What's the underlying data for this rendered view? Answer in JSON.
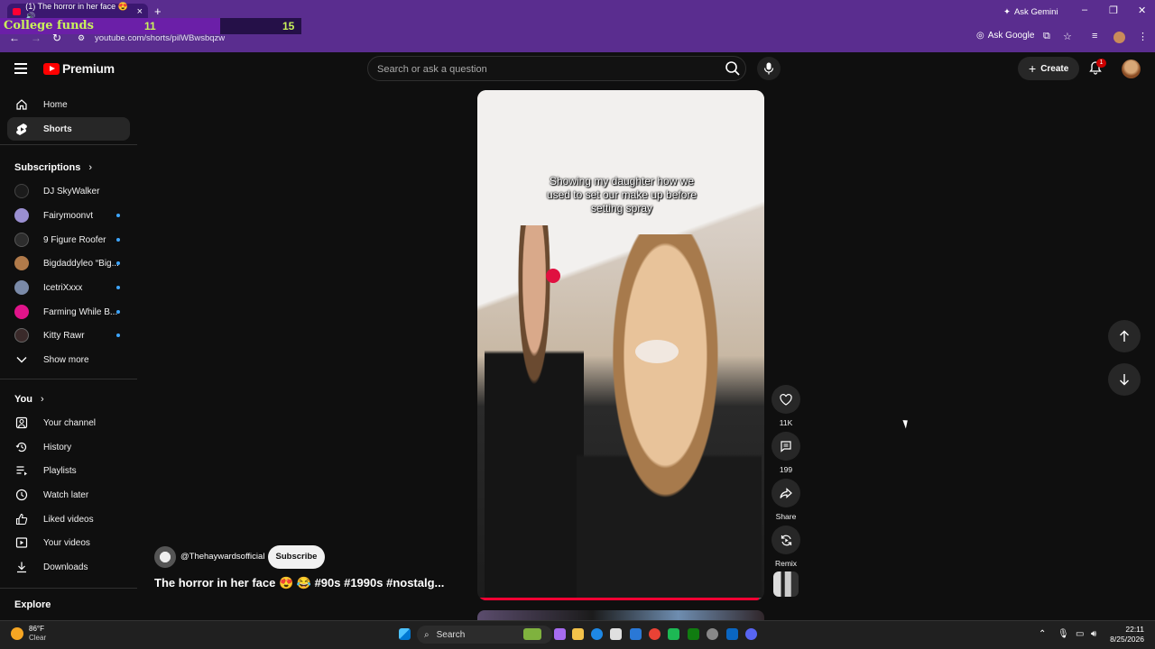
{
  "browser": {
    "tab_title": "(1) The horror in her face 😍 🔊",
    "url": "youtube.com/shorts/pilWBwsbqzw",
    "ask_gemini": "Ask Gemini",
    "ask_google": "Ask Google"
  },
  "overlay": {
    "title": "College funds",
    "value1": "11",
    "value2": "15"
  },
  "header": {
    "logo_label": "Premium",
    "search_placeholder": "Search or ask a question",
    "create_label": "Create",
    "notification_count": "1"
  },
  "sidebar": {
    "main": [
      {
        "label": "Home",
        "icon": "home-icon"
      },
      {
        "label": "Shorts",
        "icon": "shorts-icon"
      }
    ],
    "subscriptions_title": "Subscriptions",
    "subscriptions": [
      {
        "label": "DJ SkyWalker",
        "color": "#1b1b1b",
        "new": false
      },
      {
        "label": "Fairymoonvt",
        "color": "#9a8fd1",
        "new": true
      },
      {
        "label": "9 Figure Roofer",
        "color": "#2d2d2d",
        "new": true
      },
      {
        "label": "Bigdaddyleo “Big...",
        "color": "#b07a4a",
        "new": true
      },
      {
        "label": "IcetriXxxx",
        "color": "#7a8aa8",
        "new": true
      },
      {
        "label": "Farming While B...",
        "color": "#e0148a",
        "new": true
      },
      {
        "label": "Kitty Rawr",
        "color": "#3a2a2a",
        "new": true
      }
    ],
    "show_more": "Show more",
    "you_title": "You",
    "you_items": [
      {
        "label": "Your channel",
        "icon": "channel-icon"
      },
      {
        "label": "History",
        "icon": "history-icon"
      },
      {
        "label": "Playlists",
        "icon": "playlists-icon"
      },
      {
        "label": "Watch later",
        "icon": "clock-icon"
      },
      {
        "label": "Liked videos",
        "icon": "thumbs-up-icon"
      },
      {
        "label": "Your videos",
        "icon": "video-icon"
      },
      {
        "label": "Downloads",
        "icon": "download-icon"
      }
    ],
    "explore_title": "Explore"
  },
  "video": {
    "caption": "Showing my daughter how we used to set our make up before setting spray",
    "channel": "@Thehaywardsofficial",
    "subscribe_label": "Subscribe",
    "title": "The horror in her face 😍 😂 #90s #1990s #nostalg...",
    "progress": 0.98
  },
  "actions": {
    "likes": "11K",
    "comments": "199",
    "share": "Share",
    "remix": "Remix"
  },
  "taskbar": {
    "temperature": "86°F",
    "condition": "Clear",
    "search_label": "Search",
    "time": "22:11",
    "date": "8/25/2026"
  }
}
